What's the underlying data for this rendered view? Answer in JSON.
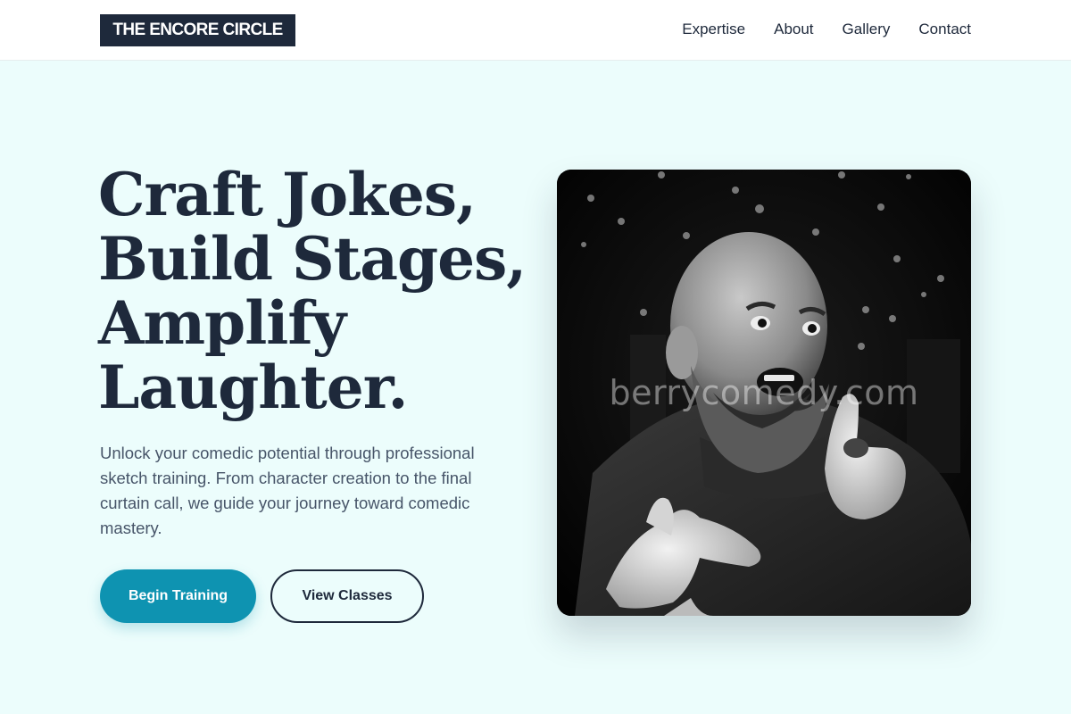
{
  "brand": {
    "name": "THE ENCORE CIRCLE"
  },
  "nav": {
    "items": [
      "Expertise",
      "About",
      "Gallery",
      "Contact"
    ]
  },
  "hero": {
    "title_lines": [
      "Craft Jokes,",
      "Build Stages,",
      "Amplify",
      "Laughter."
    ],
    "description": "Unlock your comedic potential through professional sketch training. From character creation to the final curtain call, we guide your journey toward comedic mastery.",
    "primary_cta": "Begin Training",
    "secondary_cta": "View Classes"
  },
  "image": {
    "watermark": "berrycomedy.com"
  },
  "colors": {
    "navy": "#1e293b",
    "teal": "#0e93b1",
    "background": "#ecfdfc",
    "body_text": "#475569"
  },
  "icons": []
}
